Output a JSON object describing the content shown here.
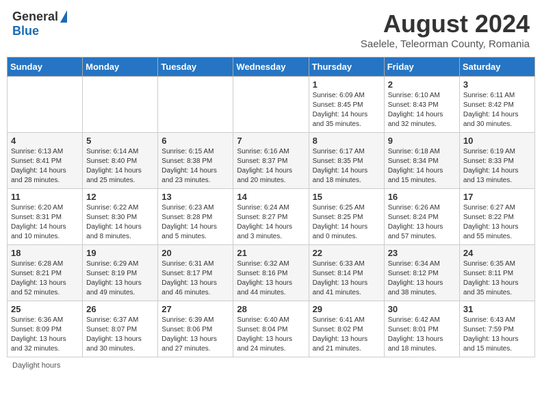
{
  "header": {
    "logo_general": "General",
    "logo_blue": "Blue",
    "main_title": "August 2024",
    "subtitle": "Saelele, Teleorman County, Romania"
  },
  "calendar": {
    "days_of_week": [
      "Sunday",
      "Monday",
      "Tuesday",
      "Wednesday",
      "Thursday",
      "Friday",
      "Saturday"
    ],
    "weeks": [
      [
        {
          "day": "",
          "info": ""
        },
        {
          "day": "",
          "info": ""
        },
        {
          "day": "",
          "info": ""
        },
        {
          "day": "",
          "info": ""
        },
        {
          "day": "1",
          "info": "Sunrise: 6:09 AM\nSunset: 8:45 PM\nDaylight: 14 hours\nand 35 minutes."
        },
        {
          "day": "2",
          "info": "Sunrise: 6:10 AM\nSunset: 8:43 PM\nDaylight: 14 hours\nand 32 minutes."
        },
        {
          "day": "3",
          "info": "Sunrise: 6:11 AM\nSunset: 8:42 PM\nDaylight: 14 hours\nand 30 minutes."
        }
      ],
      [
        {
          "day": "4",
          "info": "Sunrise: 6:13 AM\nSunset: 8:41 PM\nDaylight: 14 hours\nand 28 minutes."
        },
        {
          "day": "5",
          "info": "Sunrise: 6:14 AM\nSunset: 8:40 PM\nDaylight: 14 hours\nand 25 minutes."
        },
        {
          "day": "6",
          "info": "Sunrise: 6:15 AM\nSunset: 8:38 PM\nDaylight: 14 hours\nand 23 minutes."
        },
        {
          "day": "7",
          "info": "Sunrise: 6:16 AM\nSunset: 8:37 PM\nDaylight: 14 hours\nand 20 minutes."
        },
        {
          "day": "8",
          "info": "Sunrise: 6:17 AM\nSunset: 8:35 PM\nDaylight: 14 hours\nand 18 minutes."
        },
        {
          "day": "9",
          "info": "Sunrise: 6:18 AM\nSunset: 8:34 PM\nDaylight: 14 hours\nand 15 minutes."
        },
        {
          "day": "10",
          "info": "Sunrise: 6:19 AM\nSunset: 8:33 PM\nDaylight: 14 hours\nand 13 minutes."
        }
      ],
      [
        {
          "day": "11",
          "info": "Sunrise: 6:20 AM\nSunset: 8:31 PM\nDaylight: 14 hours\nand 10 minutes."
        },
        {
          "day": "12",
          "info": "Sunrise: 6:22 AM\nSunset: 8:30 PM\nDaylight: 14 hours\nand 8 minutes."
        },
        {
          "day": "13",
          "info": "Sunrise: 6:23 AM\nSunset: 8:28 PM\nDaylight: 14 hours\nand 5 minutes."
        },
        {
          "day": "14",
          "info": "Sunrise: 6:24 AM\nSunset: 8:27 PM\nDaylight: 14 hours\nand 3 minutes."
        },
        {
          "day": "15",
          "info": "Sunrise: 6:25 AM\nSunset: 8:25 PM\nDaylight: 14 hours\nand 0 minutes."
        },
        {
          "day": "16",
          "info": "Sunrise: 6:26 AM\nSunset: 8:24 PM\nDaylight: 13 hours\nand 57 minutes."
        },
        {
          "day": "17",
          "info": "Sunrise: 6:27 AM\nSunset: 8:22 PM\nDaylight: 13 hours\nand 55 minutes."
        }
      ],
      [
        {
          "day": "18",
          "info": "Sunrise: 6:28 AM\nSunset: 8:21 PM\nDaylight: 13 hours\nand 52 minutes."
        },
        {
          "day": "19",
          "info": "Sunrise: 6:29 AM\nSunset: 8:19 PM\nDaylight: 13 hours\nand 49 minutes."
        },
        {
          "day": "20",
          "info": "Sunrise: 6:31 AM\nSunset: 8:17 PM\nDaylight: 13 hours\nand 46 minutes."
        },
        {
          "day": "21",
          "info": "Sunrise: 6:32 AM\nSunset: 8:16 PM\nDaylight: 13 hours\nand 44 minutes."
        },
        {
          "day": "22",
          "info": "Sunrise: 6:33 AM\nSunset: 8:14 PM\nDaylight: 13 hours\nand 41 minutes."
        },
        {
          "day": "23",
          "info": "Sunrise: 6:34 AM\nSunset: 8:12 PM\nDaylight: 13 hours\nand 38 minutes."
        },
        {
          "day": "24",
          "info": "Sunrise: 6:35 AM\nSunset: 8:11 PM\nDaylight: 13 hours\nand 35 minutes."
        }
      ],
      [
        {
          "day": "25",
          "info": "Sunrise: 6:36 AM\nSunset: 8:09 PM\nDaylight: 13 hours\nand 32 minutes."
        },
        {
          "day": "26",
          "info": "Sunrise: 6:37 AM\nSunset: 8:07 PM\nDaylight: 13 hours\nand 30 minutes."
        },
        {
          "day": "27",
          "info": "Sunrise: 6:39 AM\nSunset: 8:06 PM\nDaylight: 13 hours\nand 27 minutes."
        },
        {
          "day": "28",
          "info": "Sunrise: 6:40 AM\nSunset: 8:04 PM\nDaylight: 13 hours\nand 24 minutes."
        },
        {
          "day": "29",
          "info": "Sunrise: 6:41 AM\nSunset: 8:02 PM\nDaylight: 13 hours\nand 21 minutes."
        },
        {
          "day": "30",
          "info": "Sunrise: 6:42 AM\nSunset: 8:01 PM\nDaylight: 13 hours\nand 18 minutes."
        },
        {
          "day": "31",
          "info": "Sunrise: 6:43 AM\nSunset: 7:59 PM\nDaylight: 13 hours\nand 15 minutes."
        }
      ]
    ]
  },
  "footer": {
    "daylight_label": "Daylight hours"
  }
}
